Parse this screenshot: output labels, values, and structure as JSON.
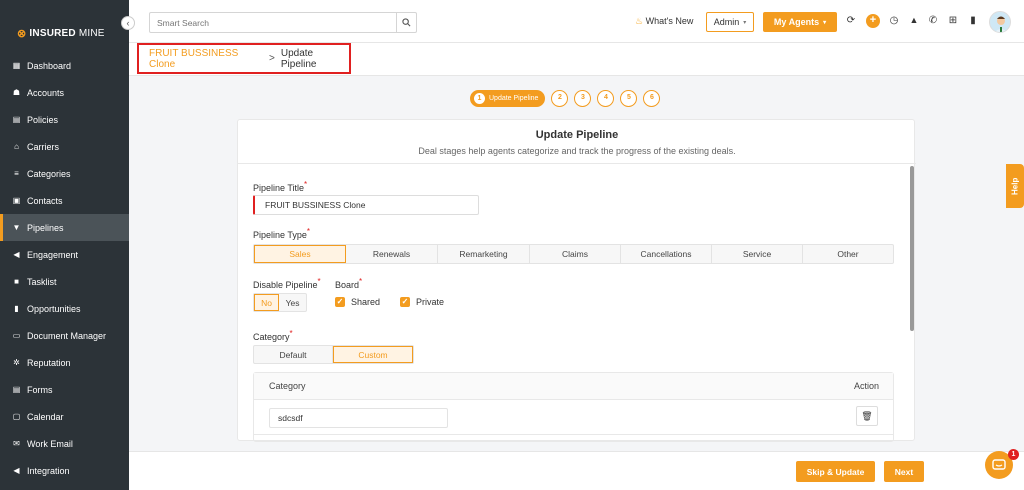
{
  "brand": {
    "logo_part1": "INSURED",
    "logo_part2": "MINE",
    "accent": "#f39c1f"
  },
  "sidebar": {
    "collapse_label": "‹",
    "items": [
      {
        "label": "Dashboard",
        "icon": "dashboard-icon"
      },
      {
        "label": "Accounts",
        "icon": "accounts-icon"
      },
      {
        "label": "Policies",
        "icon": "policies-icon"
      },
      {
        "label": "Carriers",
        "icon": "carriers-icon"
      },
      {
        "label": "Categories",
        "icon": "categories-icon"
      },
      {
        "label": "Contacts",
        "icon": "contacts-icon"
      },
      {
        "label": "Pipelines",
        "icon": "pipelines-icon",
        "active": true
      },
      {
        "label": "Engagement",
        "icon": "engagement-icon"
      },
      {
        "label": "Tasklist",
        "icon": "tasklist-icon"
      },
      {
        "label": "Opportunities",
        "icon": "opportunities-icon"
      },
      {
        "label": "Document Manager",
        "icon": "folder-icon"
      },
      {
        "label": "Reputation",
        "icon": "reputation-icon"
      },
      {
        "label": "Forms",
        "icon": "forms-icon"
      },
      {
        "label": "Calendar",
        "icon": "calendar-icon"
      },
      {
        "label": "Work Email",
        "icon": "email-icon"
      },
      {
        "label": "Integration",
        "icon": "integration-icon"
      }
    ]
  },
  "topbar": {
    "search_placeholder": "Smart Search",
    "whats_new": "What's New",
    "admin_select": "Admin",
    "my_agents": "My Agents"
  },
  "breadcrumb": {
    "parent": "FRUIT BUSSINESS Clone",
    "separator": ">",
    "current": "Update Pipeline"
  },
  "stepper": {
    "active_num": "1",
    "active_label": "Update Pipeline",
    "steps": [
      "2",
      "3",
      "4",
      "5",
      "6"
    ]
  },
  "card": {
    "title": "Update Pipeline",
    "subtitle": "Deal stages help agents categorize and track the progress of the existing deals."
  },
  "form": {
    "pipeline_title_label": "Pipeline Title",
    "pipeline_title_value": "FRUIT BUSSINESS  Clone",
    "pipeline_type_label": "Pipeline Type",
    "pipeline_types": [
      "Sales",
      "Renewals",
      "Remarketing",
      "Claims",
      "Cancellations",
      "Service",
      "Other"
    ],
    "pipeline_type_selected": "Sales",
    "disable_pipeline_label": "Disable Pipeline",
    "disable_options": [
      "No",
      "Yes"
    ],
    "disable_selected": "No",
    "board_label": "Board",
    "board_shared": "Shared",
    "board_private": "Private",
    "board_shared_checked": true,
    "board_private_checked": true,
    "category_label": "Category",
    "category_options": [
      "Default",
      "Custom"
    ],
    "category_selected": "Custom",
    "required_mark": "*"
  },
  "category_table": {
    "col_category": "Category",
    "col_action": "Action",
    "rows": [
      {
        "value": "sdcsdf"
      }
    ]
  },
  "footer": {
    "skip_update": "Skip & Update",
    "next": "Next"
  },
  "help": {
    "label": "Help"
  },
  "chat": {
    "badge": "1"
  }
}
